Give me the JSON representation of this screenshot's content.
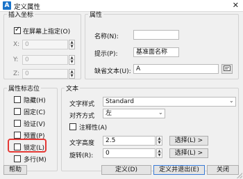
{
  "window": {
    "title": "定义属性",
    "icon_letter": "A"
  },
  "insert_point": {
    "legend": "插入坐标",
    "on_screen_label": "在屏幕上指定(O)",
    "on_screen_checked": true,
    "x_label": "X:",
    "y_label": "Y:",
    "z_label": "Z:",
    "x_value": "0",
    "y_value": "0",
    "z_value": "0"
  },
  "attribute": {
    "legend": "属性",
    "tag_label": "名称(N):",
    "tag_value": "",
    "prompt_label": "提示(P):",
    "prompt_value": "基准面名称",
    "default_label": "缺省文本(U):",
    "default_value": "A"
  },
  "modes": {
    "legend": "属性标志位",
    "items": [
      {
        "label": "隐藏(H)",
        "checked": false
      },
      {
        "label": "固定(C)",
        "checked": false
      },
      {
        "label": "验证(V)",
        "checked": false
      },
      {
        "label": "预置(P)",
        "checked": false
      },
      {
        "label": "锁定(L)",
        "checked": false
      },
      {
        "label": "多行(M)",
        "checked": false
      }
    ]
  },
  "text": {
    "legend": "文本",
    "style_label": "文字样式",
    "style_value": "Standard",
    "justify_label": "对齐方式",
    "justify_value": "左",
    "annotative_label": "注释性(A)",
    "annotative_checked": false,
    "height_label": "文字高度",
    "height_value": "2.5",
    "rotation_label": "旋转(R):",
    "rotation_value": "0",
    "select_label": "选择(L) >"
  },
  "footer": {
    "help": "帮助",
    "define": "定义(D)",
    "define_exit": "定义并退出(E)",
    "close": "关闭"
  },
  "colors": {
    "highlight": "#e53935",
    "accent": "#1a73c9"
  }
}
